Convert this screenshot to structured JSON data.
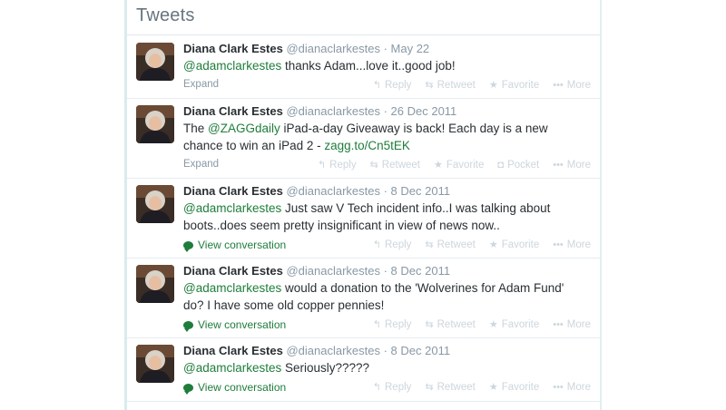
{
  "timeline": {
    "title": "Tweets",
    "tweets": [
      {
        "name": "Diana Clark Estes",
        "handle": "@dianaclarkestes",
        "date": "· May 22",
        "text_parts": [
          {
            "t": "@adamclarkestes",
            "kind": "mention"
          },
          {
            "t": " thanks Adam...love it..good job!",
            "kind": "text"
          }
        ],
        "footer_link": "Expand",
        "footer_kind": "expand",
        "actions": [
          "Reply",
          "Retweet",
          "Favorite",
          "More"
        ]
      },
      {
        "name": "Diana Clark Estes",
        "handle": "@dianaclarkestes",
        "date": "· 26 Dec 2011",
        "text_parts": [
          {
            "t": "The ",
            "kind": "text"
          },
          {
            "t": "@ZAGGdaily",
            "kind": "mention"
          },
          {
            "t": " iPad-a-day Giveaway is back! Each day is a new chance to win an iPad 2 - ",
            "kind": "text"
          },
          {
            "t": "zagg.to/Cn5tEK",
            "kind": "link"
          }
        ],
        "footer_link": "Expand",
        "footer_kind": "expand",
        "actions": [
          "Reply",
          "Retweet",
          "Favorite",
          "Pocket",
          "More"
        ]
      },
      {
        "name": "Diana Clark Estes",
        "handle": "@dianaclarkestes",
        "date": "· 8 Dec 2011",
        "text_parts": [
          {
            "t": "@adamclarkestes",
            "kind": "mention"
          },
          {
            "t": " Just saw V Tech incident info..I was talking about boots..does seem pretty insignificant in view of news now..",
            "kind": "text"
          }
        ],
        "footer_link": "View conversation",
        "footer_kind": "conversation",
        "actions": [
          "Reply",
          "Retweet",
          "Favorite",
          "More"
        ]
      },
      {
        "name": "Diana Clark Estes",
        "handle": "@dianaclarkestes",
        "date": "· 8 Dec 2011",
        "text_parts": [
          {
            "t": "@adamclarkestes",
            "kind": "mention"
          },
          {
            "t": " would a donation to the 'Wolverines for Adam Fund' do? I have some old copper pennies!",
            "kind": "text"
          }
        ],
        "footer_link": "View conversation",
        "footer_kind": "conversation",
        "actions": [
          "Reply",
          "Retweet",
          "Favorite",
          "More"
        ]
      },
      {
        "name": "Diana Clark Estes",
        "handle": "@dianaclarkestes",
        "date": "· 8 Dec 2011",
        "text_parts": [
          {
            "t": "@adamclarkestes",
            "kind": "mention"
          },
          {
            "t": " Seriously?????",
            "kind": "text"
          }
        ],
        "footer_link": "View conversation",
        "footer_kind": "conversation",
        "actions": [
          "Reply",
          "Retweet",
          "Favorite",
          "More"
        ]
      }
    ]
  },
  "action_icons": {
    "Reply": "reply-icon",
    "Retweet": "retweet-icon",
    "Favorite": "star-icon",
    "Pocket": "pocket-icon",
    "More": "more-icon"
  },
  "colors": {
    "accent_green": "#1e7d3b",
    "muted_gray": "#8899a6",
    "action_gray": "#ccd6dd"
  }
}
